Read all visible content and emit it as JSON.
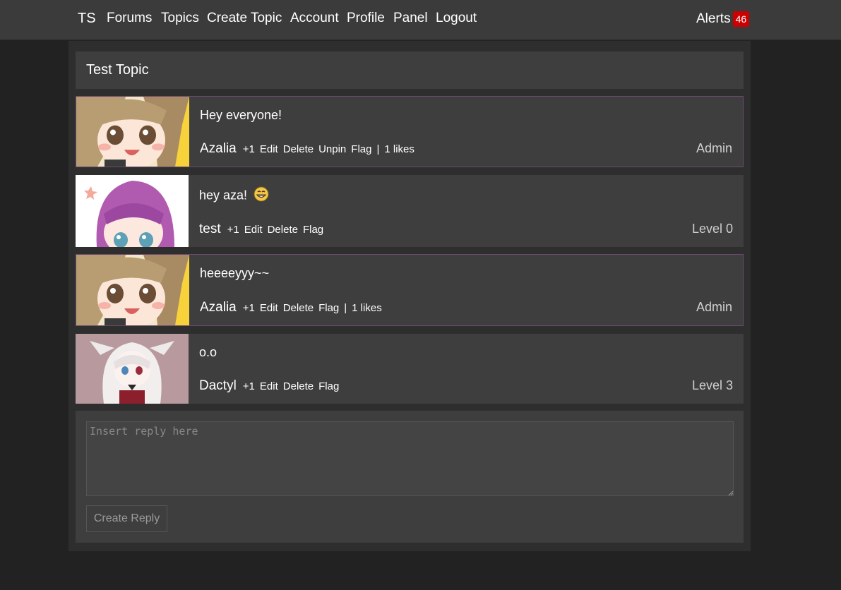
{
  "nav": {
    "brand": "TS",
    "links": [
      "Forums",
      "Topics",
      "Create Topic",
      "Account",
      "Profile",
      "Panel",
      "Logout"
    ],
    "alerts_label": "Alerts",
    "alerts_count": "46"
  },
  "topic": {
    "title": "Test Topic"
  },
  "posts": [
    {
      "content": "Hey everyone!",
      "author": "Azalia",
      "actions": [
        "+1",
        "Edit",
        "Delete",
        "Unpin",
        "Flag"
      ],
      "likes": "1 likes",
      "role": "Admin",
      "avatar_icon": "avatar-girl-light-brown-hair"
    },
    {
      "content": "hey aza!",
      "emoji_icon": "grinning-face-icon",
      "author": "test",
      "actions": [
        "+1",
        "Edit",
        "Delete",
        "Flag"
      ],
      "role": "Level 0",
      "avatar_icon": "avatar-girl-purple-hair"
    },
    {
      "content": "heeeeyyy~~",
      "author": "Azalia",
      "actions": [
        "+1",
        "Edit",
        "Delete",
        "Flag"
      ],
      "likes": "1 likes",
      "role": "Admin",
      "avatar_icon": "avatar-girl-light-brown-hair"
    },
    {
      "content": "o.o",
      "author": "Dactyl",
      "actions": [
        "+1",
        "Edit",
        "Delete",
        "Flag"
      ],
      "role": "Level 3",
      "avatar_icon": "avatar-girl-white-hair"
    }
  ],
  "reply": {
    "placeholder": "Insert reply here",
    "button_label": "Create Reply"
  },
  "colors": {
    "background": "#222222",
    "panel": "#3e3e3e",
    "admin_border": "#6b4a6e",
    "alert_badge": "#cc0000"
  }
}
